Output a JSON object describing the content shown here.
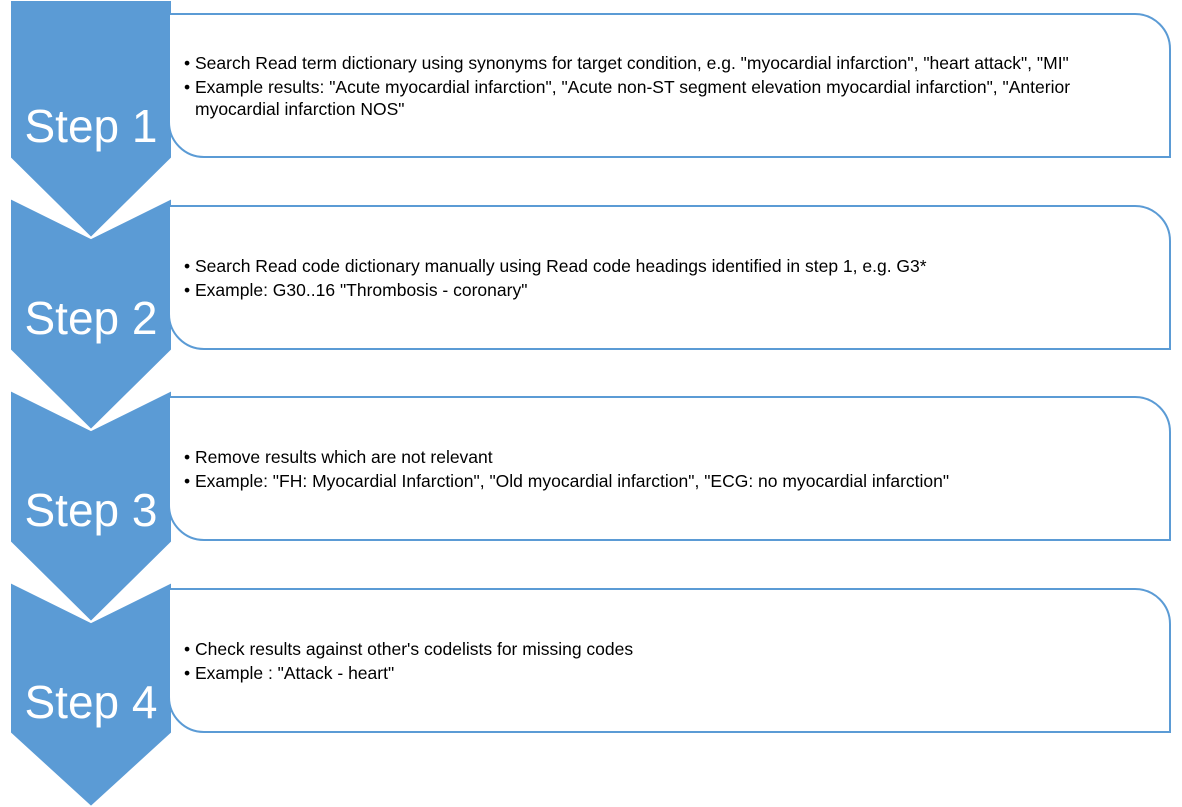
{
  "steps": [
    {
      "label": "Step 1",
      "bullets": [
        "Search Read term dictionary using synonyms for target condition, e.g. \"myocardial infarction\", \"heart attack\", \"MI\"",
        "Example results: \"Acute myocardial infarction\", \"Acute non-ST segment elevation myocardial infarction\", \"Anterior myocardial infarction NOS\""
      ]
    },
    {
      "label": "Step 2",
      "bullets": [
        "Search Read code dictionary manually using Read code headings identified in step 1, e.g. G3*",
        "Example: G30..16 \"Thrombosis - coronary\""
      ]
    },
    {
      "label": "Step 3",
      "bullets": [
        "Remove results which are not relevant",
        "Example: \"FH: Myocardial Infarction\", \"Old myocardial infarction\", \"ECG: no myocardial infarction\""
      ]
    },
    {
      "label": "Step 4",
      "bullets": [
        "Check results against other's codelists for missing codes",
        "Example : \"Attack - heart\""
      ]
    }
  ],
  "colors": {
    "chevron_fill": "#5b9bd5",
    "box_border": "#5b9bd5",
    "label_text": "#ffffff",
    "bullet_text": "#000000"
  }
}
